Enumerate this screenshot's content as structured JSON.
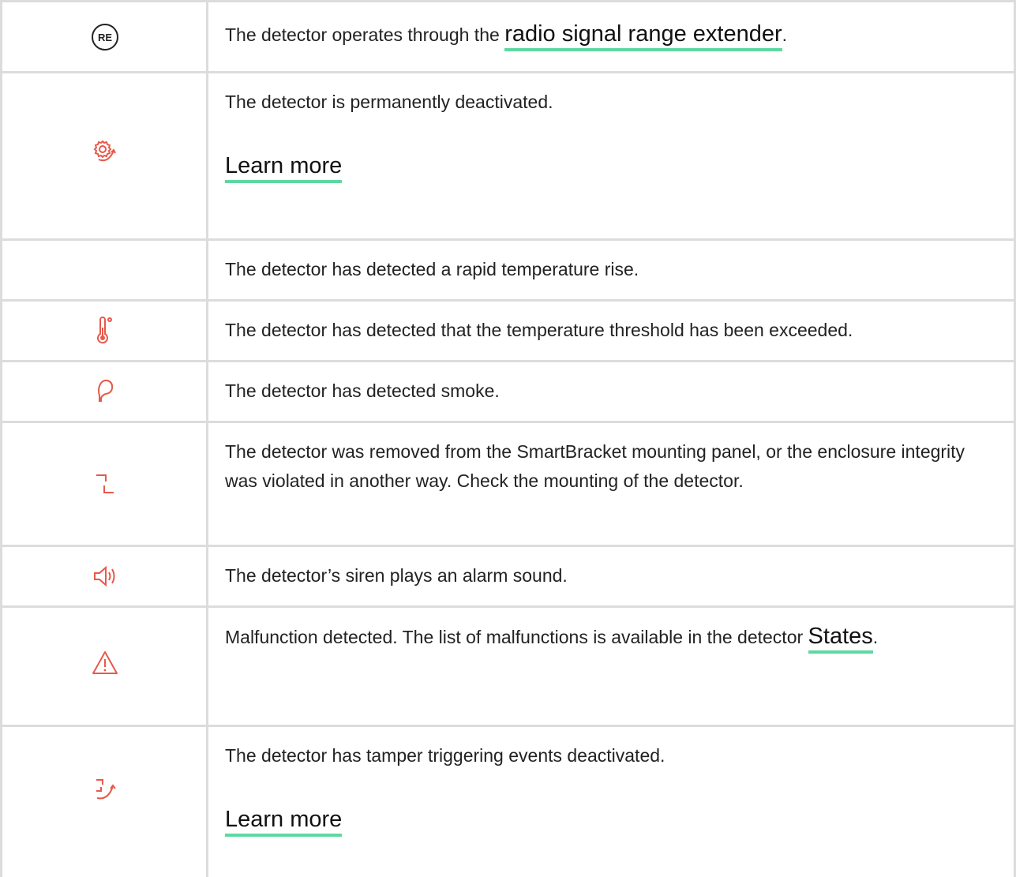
{
  "accent_color": "#e8594a",
  "link_underline_color": "#5ed8a2",
  "rows": [
    {
      "icon": "re-icon",
      "icon_text": "RE",
      "text_before": "The detector operates through the ",
      "link": "radio signal range extender",
      "text_after": "."
    },
    {
      "icon": "gear-arrow-icon",
      "text": "The detector is permanently deactivated.",
      "link": "Learn more"
    },
    {
      "icon": "",
      "text": "The detector has detected a rapid temperature rise."
    },
    {
      "icon": "thermometer-icon",
      "text": "The detector has detected that the temperature threshold has been exceeded."
    },
    {
      "icon": "smoke-icon",
      "text": "The detector has detected smoke."
    },
    {
      "icon": "tamper-icon",
      "text": "The detector was removed from the SmartBracket mounting panel, or the enclosure integrity was violated in another way. Check the mounting of the detector."
    },
    {
      "icon": "speaker-icon",
      "text": "The detector’s siren plays an alarm sound."
    },
    {
      "icon": "warning-icon",
      "text_before": "Malfunction detected. The list of malfunctions is available in the detector ",
      "link": "States",
      "text_after": "."
    },
    {
      "icon": "tamper-arrow-icon",
      "text": "The detector has tamper triggering events deactivated.",
      "link": "Learn more"
    }
  ]
}
